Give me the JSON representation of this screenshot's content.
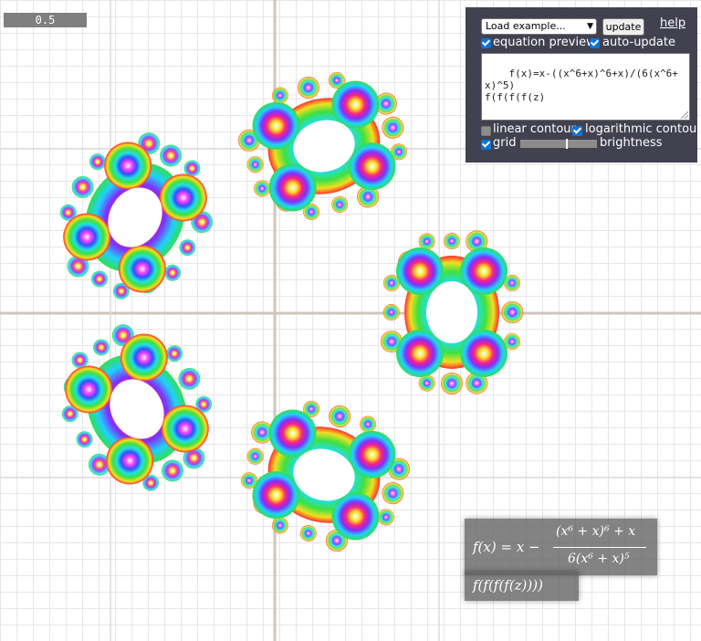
{
  "scale": {
    "value": "0.5"
  },
  "controls": {
    "example_select": "Load example...",
    "update_label": "update",
    "help_label": "help",
    "equation_preview": {
      "label": "equation preview",
      "checked": true
    },
    "auto_update": {
      "label": "auto-update",
      "checked": true
    },
    "linear_contour": {
      "label": "linear contour",
      "checked": false
    },
    "logarithmic_contour": {
      "label": "logarithmic contour",
      "checked": true
    },
    "grid": {
      "label": "grid",
      "checked": true
    },
    "brightness_label": "brightness",
    "brightness_value": 0.6,
    "equation_text": "f(x)=x-((x^6+x)^6+x)/(6(x^6+x)^5)\nf(f(f(f(z)"
  },
  "formula": {
    "lhs": "f(x) = x −",
    "numerator": "(x⁶ + x)⁶ + x",
    "denominator": "6(x⁶ + x)⁵",
    "line2": "f(f(f(f(z))))"
  },
  "colors": {
    "panel_bg": "#414150",
    "grid_minor": "#e6e6e6",
    "axis": "#c8c0b8",
    "checkbox_on": "#0a74d8"
  }
}
